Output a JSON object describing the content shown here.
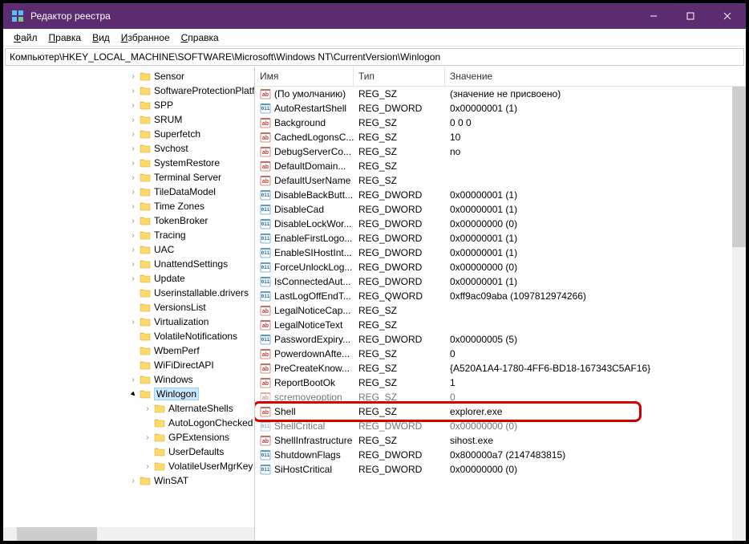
{
  "window": {
    "title": "Редактор реестра",
    "buttons": {
      "minimize": "–",
      "maximize": "▢",
      "close": "✕"
    }
  },
  "menu": {
    "file": "Файл",
    "edit": "Правка",
    "view": "Вид",
    "favorites": "Избранное",
    "help": "Справка"
  },
  "addressbar": "Компьютер\\HKEY_LOCAL_MACHINE\\SOFTWARE\\Microsoft\\Windows NT\\CurrentVersion\\Winlogon",
  "tree": [
    {
      "label": "Sensor",
      "depth": 3,
      "expander": "closed"
    },
    {
      "label": "SoftwareProtectionPlatfo",
      "depth": 3,
      "expander": "closed"
    },
    {
      "label": "SPP",
      "depth": 3,
      "expander": "closed"
    },
    {
      "label": "SRUM",
      "depth": 3,
      "expander": "closed"
    },
    {
      "label": "Superfetch",
      "depth": 3,
      "expander": "closed"
    },
    {
      "label": "Svchost",
      "depth": 3,
      "expander": "closed"
    },
    {
      "label": "SystemRestore",
      "depth": 3,
      "expander": "closed"
    },
    {
      "label": "Terminal Server",
      "depth": 3,
      "expander": "closed"
    },
    {
      "label": "TileDataModel",
      "depth": 3,
      "expander": "closed"
    },
    {
      "label": "Time Zones",
      "depth": 3,
      "expander": "closed"
    },
    {
      "label": "TokenBroker",
      "depth": 3,
      "expander": "closed"
    },
    {
      "label": "Tracing",
      "depth": 3,
      "expander": "closed"
    },
    {
      "label": "UAC",
      "depth": 3,
      "expander": "closed"
    },
    {
      "label": "UnattendSettings",
      "depth": 3,
      "expander": "closed"
    },
    {
      "label": "Update",
      "depth": 3,
      "expander": "closed"
    },
    {
      "label": "Userinstallable.drivers",
      "depth": 3,
      "expander": "none"
    },
    {
      "label": "VersionsList",
      "depth": 3,
      "expander": "none"
    },
    {
      "label": "Virtualization",
      "depth": 3,
      "expander": "closed"
    },
    {
      "label": "VolatileNotifications",
      "depth": 3,
      "expander": "none"
    },
    {
      "label": "WbemPerf",
      "depth": 3,
      "expander": "none"
    },
    {
      "label": "WiFiDirectAPI",
      "depth": 3,
      "expander": "none"
    },
    {
      "label": "Windows",
      "depth": 3,
      "expander": "closed"
    },
    {
      "label": "Winlogon",
      "depth": 3,
      "expander": "open",
      "selected": true
    },
    {
      "label": "AlternateShells",
      "depth": 4,
      "expander": "closed"
    },
    {
      "label": "AutoLogonChecked",
      "depth": 4,
      "expander": "none"
    },
    {
      "label": "GPExtensions",
      "depth": 4,
      "expander": "closed"
    },
    {
      "label": "UserDefaults",
      "depth": 4,
      "expander": "none"
    },
    {
      "label": "VolatileUserMgrKey",
      "depth": 4,
      "expander": "closed"
    },
    {
      "label": "WinSAT",
      "depth": 3,
      "expander": "closed"
    }
  ],
  "list_headers": {
    "name": "Имя",
    "type": "Тип",
    "value": "Значение"
  },
  "registry_values": [
    {
      "name": "(По умолчанию)",
      "type": "REG_SZ",
      "value": "(значение не присвоено)",
      "kind": "sz"
    },
    {
      "name": "AutoRestartShell",
      "type": "REG_DWORD",
      "value": "0x00000001 (1)",
      "kind": "dw"
    },
    {
      "name": "Background",
      "type": "REG_SZ",
      "value": "0 0 0",
      "kind": "sz"
    },
    {
      "name": "CachedLogonsC...",
      "type": "REG_SZ",
      "value": "10",
      "kind": "sz"
    },
    {
      "name": "DebugServerCo...",
      "type": "REG_SZ",
      "value": "no",
      "kind": "sz"
    },
    {
      "name": "DefaultDomain...",
      "type": "REG_SZ",
      "value": "",
      "kind": "sz"
    },
    {
      "name": "DefaultUserName",
      "type": "REG_SZ",
      "value": "",
      "kind": "sz"
    },
    {
      "name": "DisableBackButt...",
      "type": "REG_DWORD",
      "value": "0x00000001 (1)",
      "kind": "dw"
    },
    {
      "name": "DisableCad",
      "type": "REG_DWORD",
      "value": "0x00000001 (1)",
      "kind": "dw"
    },
    {
      "name": "DisableLockWor...",
      "type": "REG_DWORD",
      "value": "0x00000000 (0)",
      "kind": "dw"
    },
    {
      "name": "EnableFirstLogo...",
      "type": "REG_DWORD",
      "value": "0x00000001 (1)",
      "kind": "dw"
    },
    {
      "name": "EnableSIHostInt...",
      "type": "REG_DWORD",
      "value": "0x00000001 (1)",
      "kind": "dw"
    },
    {
      "name": "ForceUnlockLog...",
      "type": "REG_DWORD",
      "value": "0x00000000 (0)",
      "kind": "dw"
    },
    {
      "name": "IsConnectedAut...",
      "type": "REG_DWORD",
      "value": "0x00000001 (1)",
      "kind": "dw"
    },
    {
      "name": "LastLogOffEndT...",
      "type": "REG_QWORD",
      "value": "0xff9ac09aba (1097812974266)",
      "kind": "dw"
    },
    {
      "name": "LegalNoticeCap...",
      "type": "REG_SZ",
      "value": "",
      "kind": "sz"
    },
    {
      "name": "LegalNoticeText",
      "type": "REG_SZ",
      "value": "",
      "kind": "sz"
    },
    {
      "name": "PasswordExpiry...",
      "type": "REG_DWORD",
      "value": "0x00000005 (5)",
      "kind": "dw"
    },
    {
      "name": "PowerdownAfte...",
      "type": "REG_SZ",
      "value": "0",
      "kind": "sz"
    },
    {
      "name": "PreCreateKnow...",
      "type": "REG_SZ",
      "value": "{A520A1A4-1780-4FF6-BD18-167343C5AF16}",
      "kind": "sz"
    },
    {
      "name": "ReportBootOk",
      "type": "REG_SZ",
      "value": "1",
      "kind": "sz"
    },
    {
      "name": "scremoveoption",
      "type": "REG_SZ",
      "value": "0",
      "kind": "sz",
      "dim": true
    },
    {
      "name": "Shell",
      "type": "REG_SZ",
      "value": "explorer.exe",
      "kind": "sz",
      "highlight": true
    },
    {
      "name": "ShellCritical",
      "type": "REG_DWORD",
      "value": "0x00000000 (0)",
      "kind": "dw",
      "dim": true
    },
    {
      "name": "ShellInfrastructure",
      "type": "REG_SZ",
      "value": "sihost.exe",
      "kind": "sz"
    },
    {
      "name": "ShutdownFlags",
      "type": "REG_DWORD",
      "value": "0x800000a7 (2147483815)",
      "kind": "dw"
    },
    {
      "name": "SiHostCritical",
      "type": "REG_DWORD",
      "value": "0x00000000 (0)",
      "kind": "dw"
    }
  ]
}
